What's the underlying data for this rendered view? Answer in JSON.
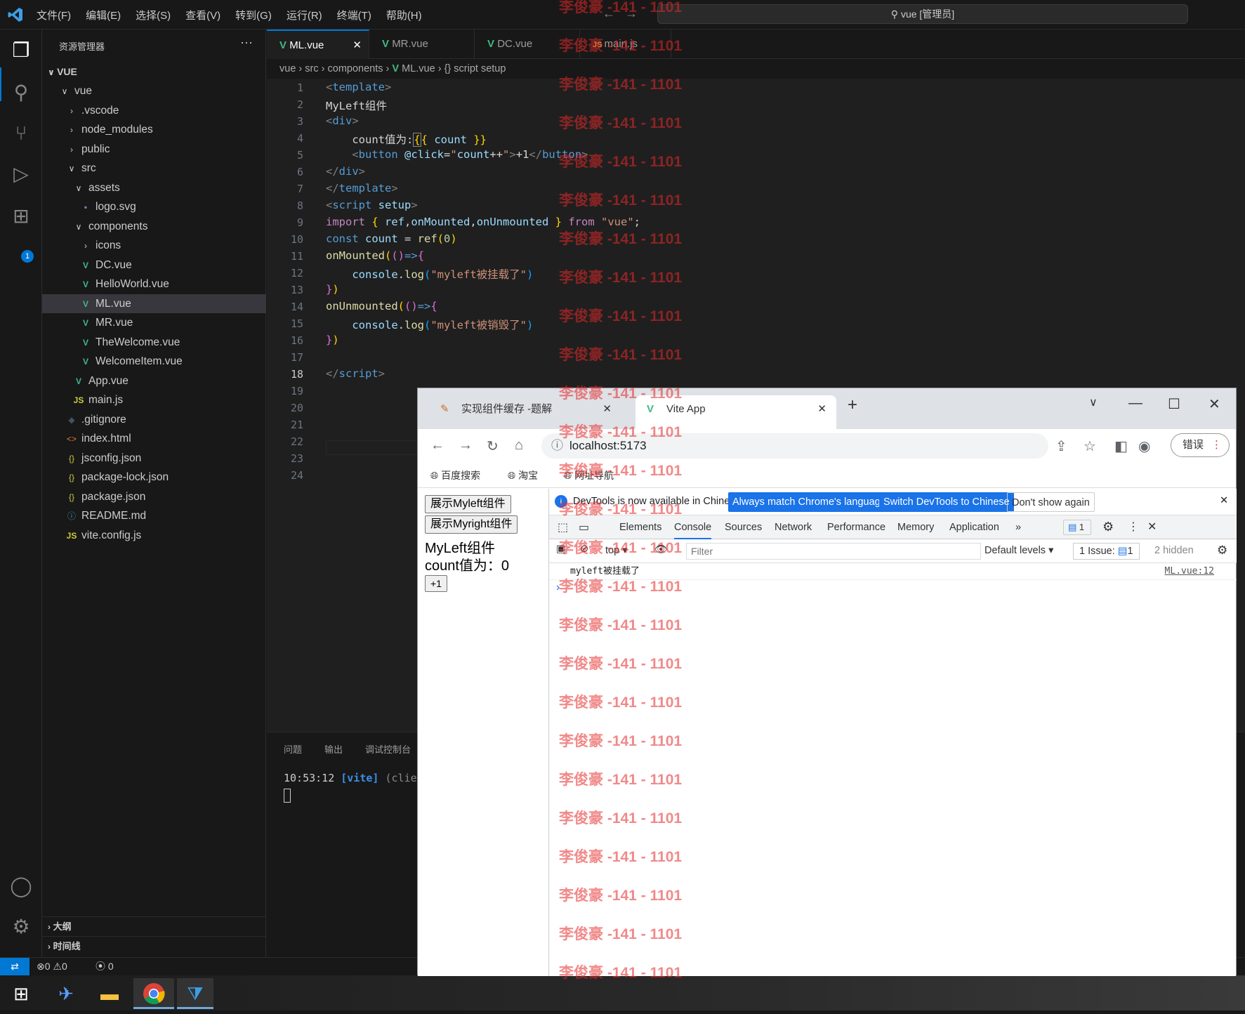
{
  "titlebar": {
    "menus": [
      "文件(F)",
      "编辑(E)",
      "选择(S)",
      "查看(V)",
      "转到(G)",
      "运行(R)",
      "终端(T)",
      "帮助(H)"
    ],
    "search": "vue [管理员]"
  },
  "sidebar": {
    "title": "资源管理器",
    "root": "VUE",
    "items": [
      {
        "label": "vue",
        "icon": "chevron-down",
        "indent": 1
      },
      {
        "label": ".vscode",
        "icon": "chevron-right",
        "indent": 2
      },
      {
        "label": "node_modules",
        "icon": "chevron-right",
        "indent": 2
      },
      {
        "label": "public",
        "icon": "chevron-right",
        "indent": 2
      },
      {
        "label": "src",
        "icon": "chevron-down",
        "indent": 2
      },
      {
        "label": "assets",
        "icon": "chevron-down",
        "indent": 3
      },
      {
        "label": "logo.svg",
        "icon": "svg",
        "indent": 4
      },
      {
        "label": "components",
        "icon": "chevron-down",
        "indent": 3
      },
      {
        "label": "icons",
        "icon": "chevron-right",
        "indent": 4
      },
      {
        "label": "DC.vue",
        "icon": "vue",
        "indent": 4
      },
      {
        "label": "HelloWorld.vue",
        "icon": "vue",
        "indent": 4
      },
      {
        "label": "ML.vue",
        "icon": "vue",
        "indent": 4,
        "selected": true
      },
      {
        "label": "MR.vue",
        "icon": "vue",
        "indent": 4
      },
      {
        "label": "TheWelcome.vue",
        "icon": "vue",
        "indent": 4
      },
      {
        "label": "WelcomeItem.vue",
        "icon": "vue",
        "indent": 4
      },
      {
        "label": "App.vue",
        "icon": "vue",
        "indent": 3
      },
      {
        "label": "main.js",
        "icon": "js",
        "indent": 3
      },
      {
        "label": ".gitignore",
        "icon": "git",
        "indent": 2
      },
      {
        "label": "index.html",
        "icon": "html",
        "indent": 2
      },
      {
        "label": "jsconfig.json",
        "icon": "json",
        "indent": 2
      },
      {
        "label": "package-lock.json",
        "icon": "json",
        "indent": 2
      },
      {
        "label": "package.json",
        "icon": "json",
        "indent": 2
      },
      {
        "label": "README.md",
        "icon": "md",
        "indent": 2
      },
      {
        "label": "vite.config.js",
        "icon": "js",
        "indent": 2
      }
    ],
    "outline": "大纲",
    "timeline": "时间线",
    "badge": "1"
  },
  "tabs": [
    {
      "label": "ML.vue",
      "icon": "vue",
      "active": true,
      "close": "✕"
    },
    {
      "label": "MR.vue",
      "icon": "vue"
    },
    {
      "label": "DC.vue",
      "icon": "vue"
    },
    {
      "label": "main.js",
      "icon": "js"
    }
  ],
  "breadcrumb": [
    "vue",
    "src",
    "components",
    "ML.vue",
    "{} script setup"
  ],
  "code_lines": [
    "1",
    "2",
    "3",
    "4",
    "5",
    "6",
    "7",
    "8",
    "9",
    "10",
    "11",
    "12",
    "13",
    "14",
    "15",
    "16",
    "17",
    "18",
    "19",
    "20",
    "21",
    "22",
    "23",
    "24"
  ],
  "panel": {
    "tabs": [
      "问题",
      "输出",
      "调试控制台"
    ],
    "terminal_time": "10:53:12",
    "terminal_tag": "[vite]",
    "terminal_rest": "(clie"
  },
  "status": {
    "errors": "0",
    "warnings": "0",
    "ports": "0"
  },
  "chrome": {
    "tabs": [
      {
        "label": "实现组件缓存 -题解"
      },
      {
        "label": "Vite App",
        "active": true
      }
    ],
    "url": "localhost:5173",
    "bookmarks": [
      "百度搜索",
      "淘宝",
      "网址导航"
    ],
    "profile_btn": "错误",
    "page": {
      "btn1": "展示Myleft组件",
      "btn2": "展示Myright组件",
      "title": "MyLeft组件",
      "count": "count值为：0",
      "inc": "+1"
    },
    "devtools": {
      "info": "DevTools is now available in Chinese!",
      "btn_match": "Always match Chrome's language",
      "btn_switch": "Switch DevTools to Chinese",
      "btn_dont": "Don't show again",
      "tabs": [
        "Elements",
        "Console",
        "Sources",
        "Network",
        "Performance",
        "Memory",
        "Application"
      ],
      "msg_count": "1",
      "context": "top",
      "filter_placeholder": "Filter",
      "levels": "Default levels",
      "issues": "1 Issue:",
      "issues_count": "1",
      "hidden": "2 hidden",
      "log_text": "myleft被挂载了",
      "log_src": "ML.vue:12"
    }
  },
  "watermark": "李俊豪 -141 - 1101",
  "colors": {
    "accent": "#0078d4",
    "vue": "#41b883",
    "watermark": "#e62828"
  }
}
